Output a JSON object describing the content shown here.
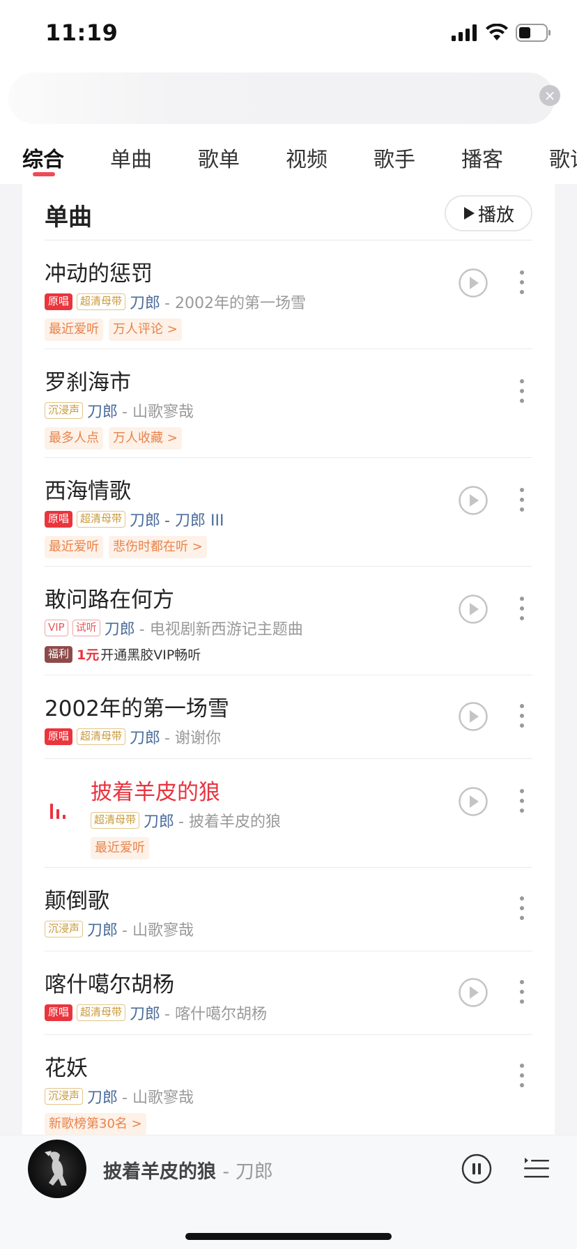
{
  "status_bar": {
    "time": "11:19"
  },
  "search": {
    "value": ""
  },
  "tabs": [
    {
      "label": "综合",
      "active": true
    },
    {
      "label": "单曲"
    },
    {
      "label": "歌单"
    },
    {
      "label": "视频"
    },
    {
      "label": "歌手"
    },
    {
      "label": "播客"
    },
    {
      "label": "歌词"
    }
  ],
  "section": {
    "title": "单曲",
    "play_all_label": "播放"
  },
  "songs": [
    {
      "title": "冲动的惩罚",
      "badges": [
        "原唱",
        "超清母带"
      ],
      "artist": "刀郎",
      "album": "- 2002年的第一场雪",
      "tags": [
        "最近爱听",
        "万人评论 >"
      ],
      "has_play": true
    },
    {
      "title": "罗刹海市",
      "badges": [
        "沉浸声"
      ],
      "artist": "刀郎",
      "album": "- 山歌寥哉",
      "tags": [
        "最多人点",
        "万人收藏 >"
      ],
      "has_play": false
    },
    {
      "title": "西海情歌",
      "badges": [
        "原唱",
        "超清母带"
      ],
      "artist": "刀郎",
      "album": "- 刀郎 III",
      "tags": [
        "最近爱听",
        "悲伤时都在听 >"
      ],
      "has_play": true
    },
    {
      "title": "敢问路在何方",
      "badges": [
        "VIP",
        "试听"
      ],
      "artist": "刀郎",
      "album": "- 电视剧新西游记主题曲",
      "promo": {
        "badge": "福利",
        "highlight": "1元",
        "text": "开通黑胶VIP畅听"
      },
      "has_play": true
    },
    {
      "title": "2002年的第一场雪",
      "badges": [
        "原唱",
        "超清母带"
      ],
      "artist": "刀郎",
      "album": "- 谢谢你",
      "has_play": true
    },
    {
      "title": "披着羊皮的狼",
      "badges": [
        "超清母带"
      ],
      "artist": "刀郎",
      "album": "- 披着羊皮的狼",
      "tags": [
        "最近爱听"
      ],
      "has_play": true,
      "playing": true
    },
    {
      "title": "颠倒歌",
      "badges": [
        "沉浸声"
      ],
      "artist": "刀郎",
      "album": "- 山歌寥哉",
      "has_play": false
    },
    {
      "title": "喀什噶尔胡杨",
      "badges": [
        "原唱",
        "超清母带"
      ],
      "artist": "刀郎",
      "album": "- 喀什噶尔胡杨",
      "has_play": true
    },
    {
      "title": "花妖",
      "badges": [
        "沉浸声"
      ],
      "artist": "刀郎",
      "album": "- 山歌寥哉",
      "tags": [
        "新歌榜第30名 >"
      ],
      "has_play": false
    }
  ],
  "now_playing": {
    "title": "披着羊皮的狼",
    "artist": "- 刀郎"
  },
  "colors": {
    "accent": "#e8343f",
    "artist": "#4a6c9a",
    "tag_text": "#e8834a"
  }
}
